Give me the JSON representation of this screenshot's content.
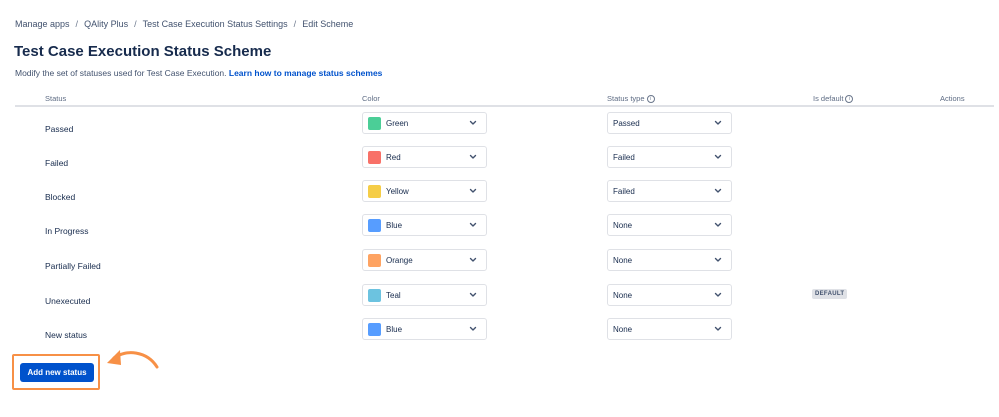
{
  "breadcrumb": [
    "Manage apps",
    "QAlity Plus",
    "Test Case Execution Status Settings",
    "Edit Scheme"
  ],
  "page": {
    "title": "Test Case Execution Status Scheme",
    "description": "Modify the set of statuses used for Test Case Execution.",
    "link": "Learn how to manage status schemes"
  },
  "table": {
    "headers": {
      "status": "Status",
      "color": "Color",
      "status_type": "Status type",
      "is_default": "Is default",
      "actions": "Actions"
    },
    "rows": [
      {
        "status": "Passed",
        "color": "Green",
        "color_hex": "#4bce97",
        "type": "Passed",
        "default": ""
      },
      {
        "status": "Failed",
        "color": "Red",
        "color_hex": "#f87168",
        "type": "Failed",
        "default": ""
      },
      {
        "status": "Blocked",
        "color": "Yellow",
        "color_hex": "#f5cd47",
        "type": "Failed",
        "default": ""
      },
      {
        "status": "In Progress",
        "color": "Blue",
        "color_hex": "#579dff",
        "type": "None",
        "default": ""
      },
      {
        "status": "Partially Failed",
        "color": "Orange",
        "color_hex": "#fea362",
        "type": "None",
        "default": ""
      },
      {
        "status": "Unexecuted",
        "color": "Teal",
        "color_hex": "#6cc3e0",
        "type": "None",
        "default": "DEFAULT"
      },
      {
        "status": "New status",
        "color": "Blue",
        "color_hex": "#579dff",
        "type": "None",
        "default": ""
      }
    ]
  },
  "add_button": "Add new status",
  "colors": {
    "primary": "#0052cc",
    "highlight": "#f79046"
  },
  "icons": {
    "chevron": "chevron-down-icon",
    "info": "info-icon",
    "arrow": "pointer-arrow-icon"
  }
}
